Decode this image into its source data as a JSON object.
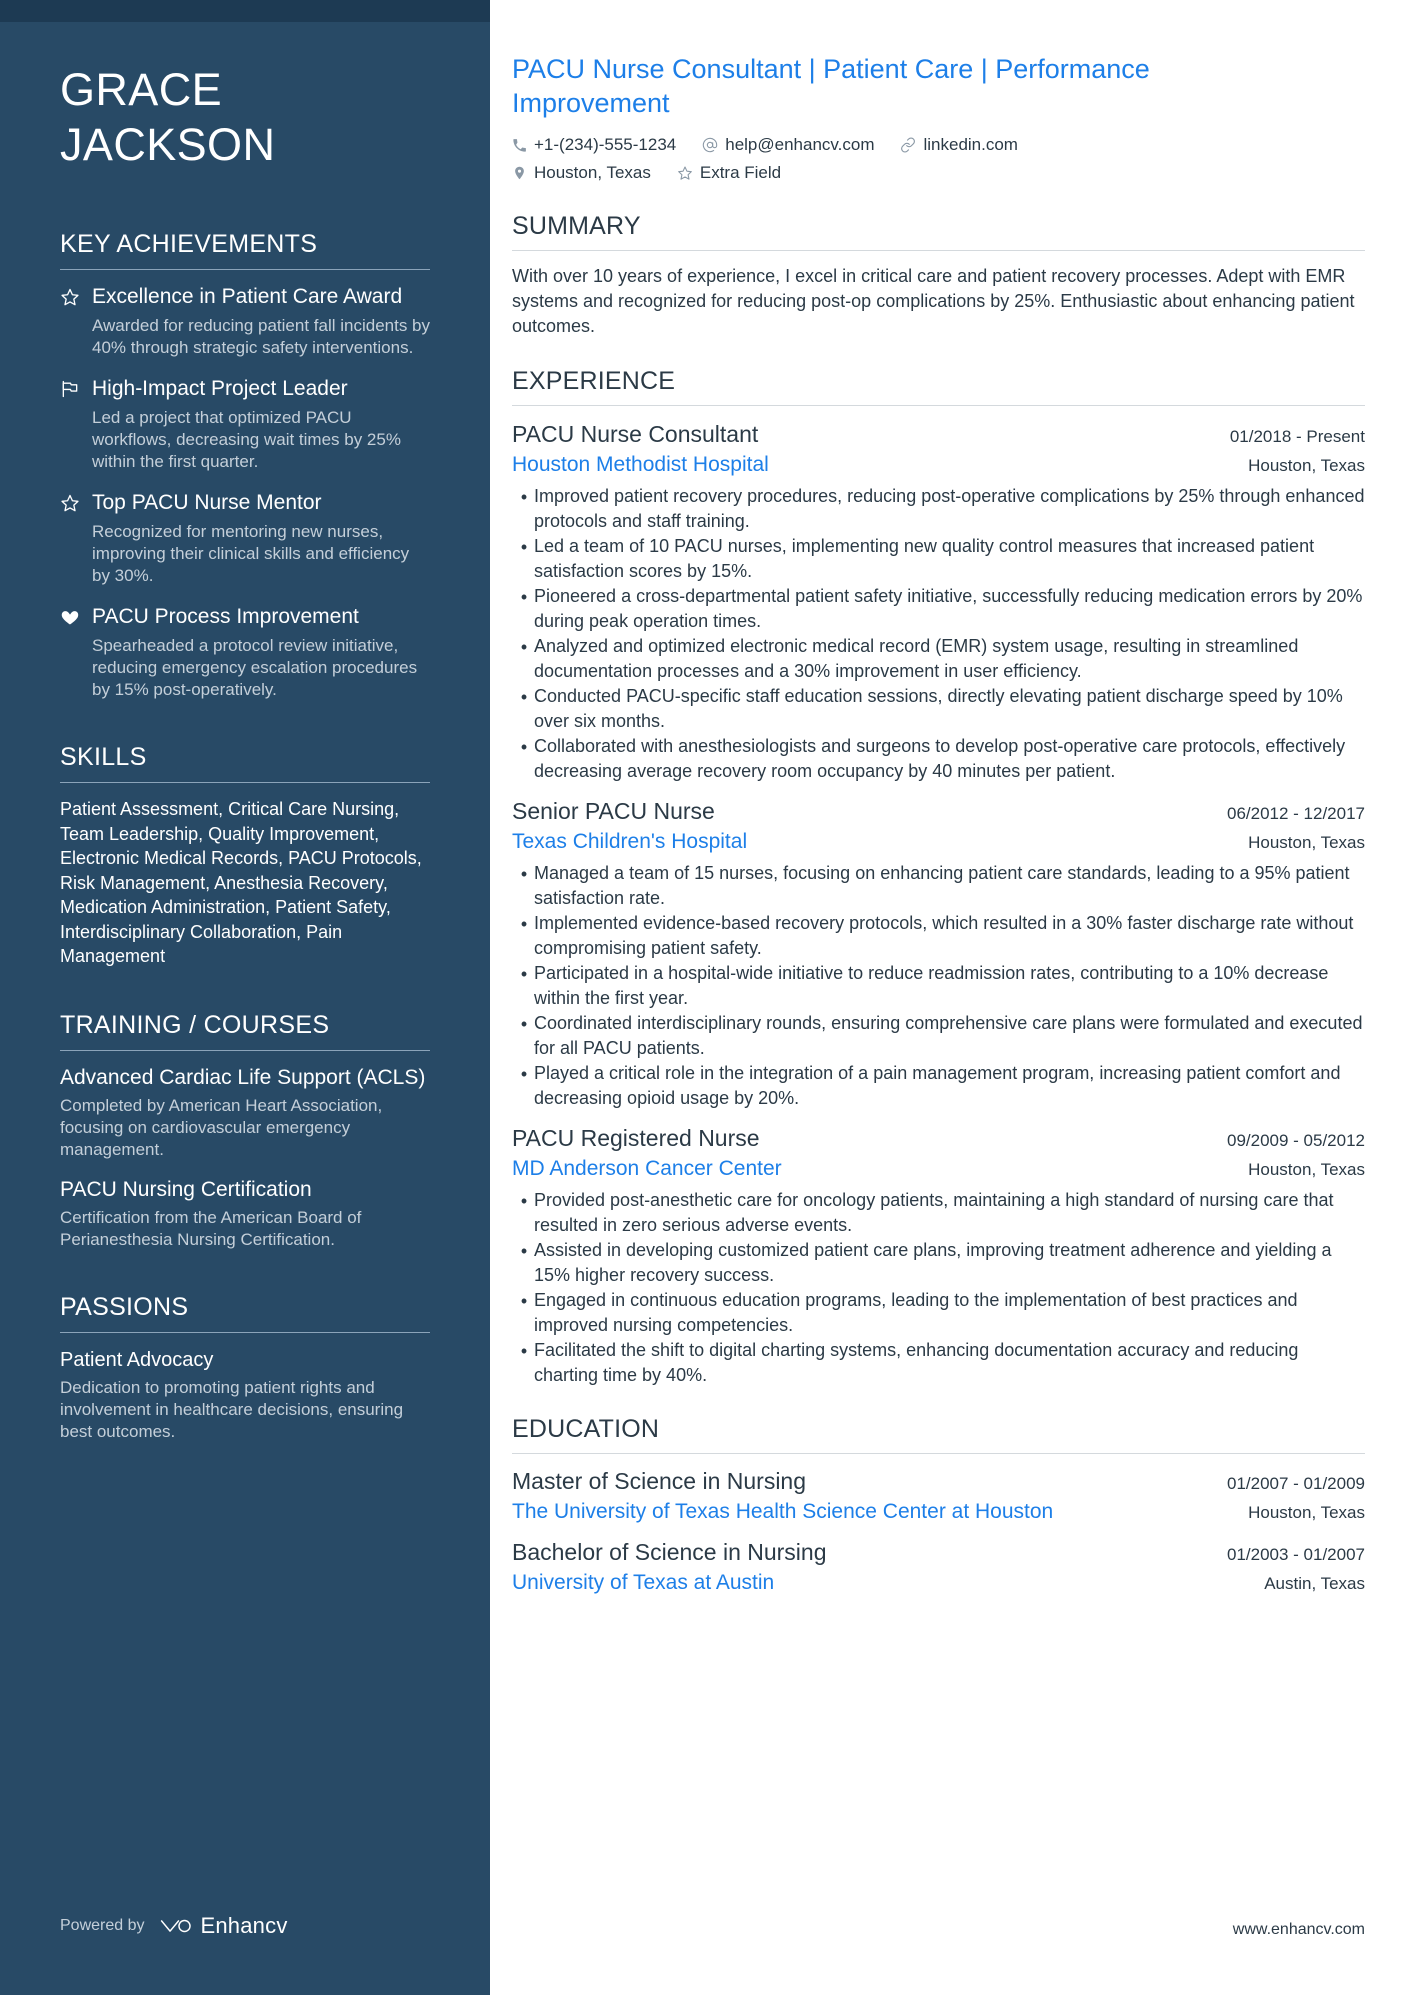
{
  "sidebar": {
    "name_lines": [
      "GRACE",
      "JACKSON"
    ],
    "sections": {
      "achievements": {
        "heading": "KEY ACHIEVEMENTS",
        "items": [
          {
            "icon": "star-outline-icon",
            "title": "Excellence in Patient Care Award",
            "description": "Awarded for reducing patient fall incidents by 40% through strategic safety interventions."
          },
          {
            "icon": "flag-icon",
            "title": "High-Impact Project Leader",
            "description": "Led a project that optimized PACU workflows, decreasing wait times by 25% within the first quarter."
          },
          {
            "icon": "star-outline-icon",
            "title": "Top PACU Nurse Mentor",
            "description": "Recognized for mentoring new nurses, improving their clinical skills and efficiency by 30%."
          },
          {
            "icon": "heart-filled-icon",
            "title": "PACU Process Improvement",
            "description": "Spearheaded a protocol review initiative, reducing emergency escalation procedures by 15% post-operatively."
          }
        ]
      },
      "skills": {
        "heading": "SKILLS",
        "text": "Patient Assessment, Critical Care Nursing, Team Leadership, Quality Improvement, Electronic Medical Records, PACU Protocols, Risk Management, Anesthesia Recovery, Medication Administration, Patient Safety, Interdisciplinary Collaboration, Pain Management"
      },
      "training": {
        "heading": "TRAINING / COURSES",
        "items": [
          {
            "title": "Advanced Cardiac Life Support (ACLS)",
            "description": "Completed by American Heart Association, focusing on cardiovascular emergency management."
          },
          {
            "title": "PACU Nursing Certification",
            "description": "Certification from the American Board of Perianesthesia Nursing Certification."
          }
        ]
      },
      "passions": {
        "heading": "PASSIONS",
        "items": [
          {
            "title": "Patient Advocacy",
            "description": "Dedication to promoting patient rights and involvement in healthcare decisions, ensuring best outcomes."
          }
        ]
      }
    },
    "footer": {
      "powered_by": "Powered by",
      "brand": "Enhancv"
    }
  },
  "main": {
    "headline": "PACU Nurse Consultant | Patient Care | Performance Improvement",
    "contact": {
      "row1": [
        {
          "icon": "phone-icon",
          "text": "+1-(234)-555-1234"
        },
        {
          "icon": "at-sign-icon",
          "text": "help@enhancv.com"
        },
        {
          "icon": "link-icon",
          "text": "linkedin.com"
        }
      ],
      "row2": [
        {
          "icon": "location-pin-icon",
          "text": "Houston, Texas"
        },
        {
          "icon": "star-outline-icon",
          "text": "Extra Field"
        }
      ]
    },
    "summary": {
      "heading": "SUMMARY",
      "text": "With over 10 years of experience, I excel in critical care and patient recovery processes. Adept with EMR systems and recognized for reducing post-op complications by 25%. Enthusiastic about enhancing patient outcomes."
    },
    "experience": {
      "heading": "EXPERIENCE",
      "entries": [
        {
          "title": "PACU Nurse Consultant",
          "dates": "01/2018 - Present",
          "org": "Houston Methodist Hospital",
          "location": "Houston, Texas",
          "bullets": [
            "Improved patient recovery procedures, reducing post-operative complications by 25% through enhanced protocols and staff training.",
            "Led a team of 10 PACU nurses, implementing new quality control measures that increased patient satisfaction scores by 15%.",
            "Pioneered a cross-departmental patient safety initiative, successfully reducing medication errors by 20% during peak operation times.",
            "Analyzed and optimized electronic medical record (EMR) system usage, resulting in streamlined documentation processes and a 30% improvement in user efficiency.",
            "Conducted PACU-specific staff education sessions, directly elevating patient discharge speed by 10% over six months.",
            "Collaborated with anesthesiologists and surgeons to develop post-operative care protocols, effectively decreasing average recovery room occupancy by 40 minutes per patient."
          ]
        },
        {
          "title": "Senior PACU Nurse",
          "dates": "06/2012 - 12/2017",
          "org": "Texas Children's Hospital",
          "location": "Houston, Texas",
          "bullets": [
            "Managed a team of 15 nurses, focusing on enhancing patient care standards, leading to a 95% patient satisfaction rate.",
            "Implemented evidence-based recovery protocols, which resulted in a 30% faster discharge rate without compromising patient safety.",
            "Participated in a hospital-wide initiative to reduce readmission rates, contributing to a 10% decrease within the first year.",
            "Coordinated interdisciplinary rounds, ensuring comprehensive care plans were formulated and executed for all PACU patients.",
            "Played a critical role in the integration of a pain management program, increasing patient comfort and decreasing opioid usage by 20%."
          ]
        },
        {
          "title": "PACU Registered Nurse",
          "dates": "09/2009 - 05/2012",
          "org": "MD Anderson Cancer Center",
          "location": "Houston, Texas",
          "bullets": [
            "Provided post-anesthetic care for oncology patients, maintaining a high standard of nursing care that resulted in zero serious adverse events.",
            "Assisted in developing customized patient care plans, improving treatment adherence and yielding a 15% higher recovery success.",
            "Engaged in continuous education programs, leading to the implementation of best practices and improved nursing competencies.",
            "Facilitated the shift to digital charting systems, enhancing documentation accuracy and reducing charting time by 40%."
          ]
        }
      ]
    },
    "education": {
      "heading": "EDUCATION",
      "entries": [
        {
          "title": "Master of Science in Nursing",
          "dates": "01/2007 - 01/2009",
          "org": "The University of Texas Health Science Center at Houston",
          "location": "Houston, Texas"
        },
        {
          "title": "Bachelor of Science in Nursing",
          "dates": "01/2003 - 01/2007",
          "org": "University of Texas at Austin",
          "location": "Austin, Texas"
        }
      ]
    },
    "footer": {
      "website": "www.enhancv.com"
    }
  },
  "colors": {
    "sidebar_bg": "#284a66",
    "sidebar_top_strip": "#1d3a53",
    "accent_blue": "#1d7fe8",
    "body_text": "#2b3a46",
    "muted_text": "#c4cfd9"
  }
}
